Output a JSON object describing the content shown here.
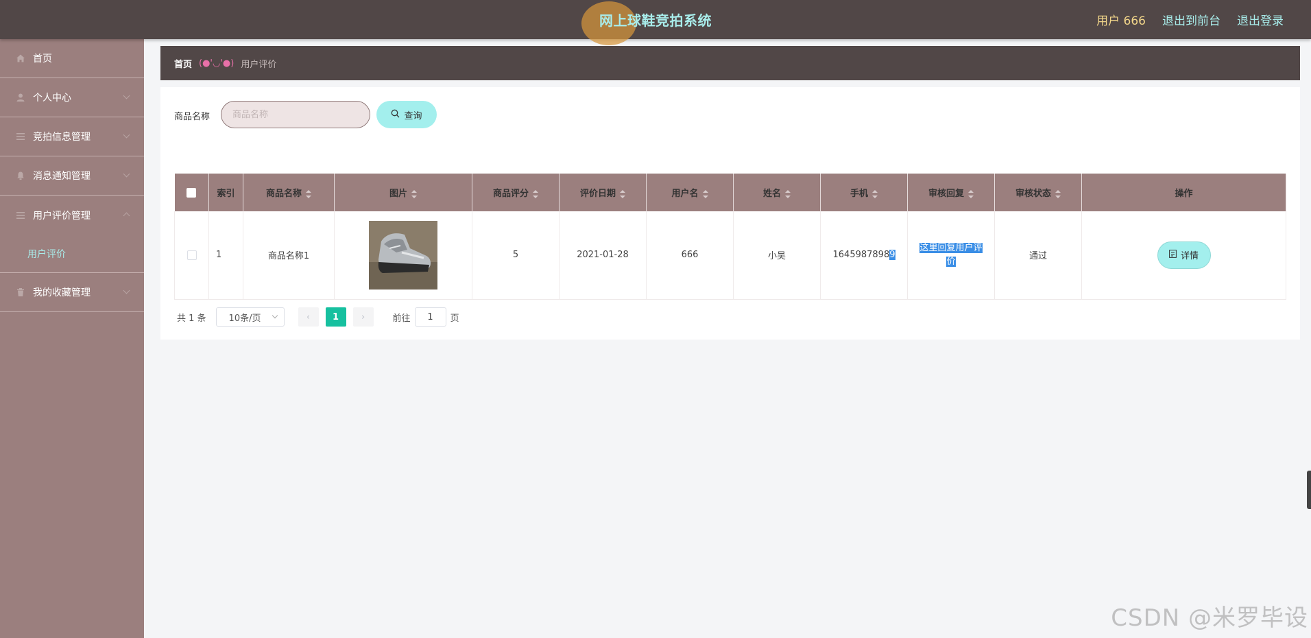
{
  "header": {
    "title": "网上球鞋竞拍系统",
    "user_label": "用户 666",
    "to_frontend": "退出到前台",
    "logout": "退出登录"
  },
  "sidebar": {
    "items": [
      {
        "label": "首页",
        "icon": "home-icon"
      },
      {
        "label": "个人中心",
        "icon": "user-icon"
      },
      {
        "label": "竞拍信息管理",
        "icon": "list-icon"
      },
      {
        "label": "消息通知管理",
        "icon": "bell-icon"
      },
      {
        "label": "用户评价管理",
        "icon": "list-icon"
      },
      {
        "label": "用户评价",
        "icon": ""
      },
      {
        "label": "我的收藏管理",
        "icon": "trash-icon"
      }
    ]
  },
  "breadcrumb": {
    "home": "首页",
    "separator": "(●'◡'●)",
    "current": "用户评价"
  },
  "search": {
    "label": "商品名称",
    "placeholder": "商品名称",
    "value": "",
    "button": "查询"
  },
  "table": {
    "columns": [
      "索引",
      "商品名称",
      "图片",
      "商品评分",
      "评价日期",
      "用户名",
      "姓名",
      "手机",
      "审核回复",
      "审核状态",
      "操作"
    ],
    "rows": [
      {
        "index": "1",
        "name": "商品名称1",
        "image": "sneaker-photo",
        "score": "5",
        "date": "2021-01-28",
        "username": "666",
        "realname": "小吴",
        "phone_prefix": "1645987898",
        "phone_last": "9",
        "reply": "这里回复用户评价",
        "status": "通过",
        "action": "详情"
      }
    ]
  },
  "pagination": {
    "total": "共 1 条",
    "page_size": "10条/页",
    "current_page": "1",
    "goto_label": "前往",
    "goto_value": "1",
    "page_unit": "页"
  },
  "watermark": "CSDN @米罗毕设",
  "colors": {
    "header_bg": "#514747",
    "sidebar_bg": "#9b7f7e",
    "accent": "#a3efed",
    "active_page": "#16c09f"
  }
}
